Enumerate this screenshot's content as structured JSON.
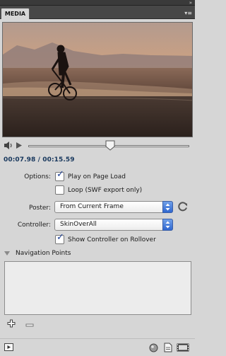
{
  "panel": {
    "tab_label": "MEDIA",
    "collapse_glyph": "»",
    "menu_glyph": "▾≡"
  },
  "transport": {
    "timecode": "00:07.98 / 00:15.59",
    "progress_fraction": 0.51
  },
  "options": {
    "label": "Options:",
    "play_on_load": {
      "label": "Play on Page Load",
      "checked": true
    },
    "loop": {
      "label": "Loop (SWF export only)",
      "checked": false
    }
  },
  "poster": {
    "label": "Poster:",
    "value": "From Current Frame"
  },
  "controller": {
    "label": "Controller:",
    "value": "SkinOverAll",
    "show_on_rollover": {
      "label": "Show Controller on Rollover",
      "checked": true
    }
  },
  "navigation": {
    "label": "Navigation Points",
    "expanded": true
  },
  "icons": {
    "speaker": "speaker-icon",
    "play": "play-icon",
    "refresh": "refresh-icon",
    "add": "add-icon",
    "remove": "remove-icon",
    "preview": "preview-icon",
    "url": "url-icon",
    "new_page": "new-page-icon",
    "film": "film-icon"
  }
}
